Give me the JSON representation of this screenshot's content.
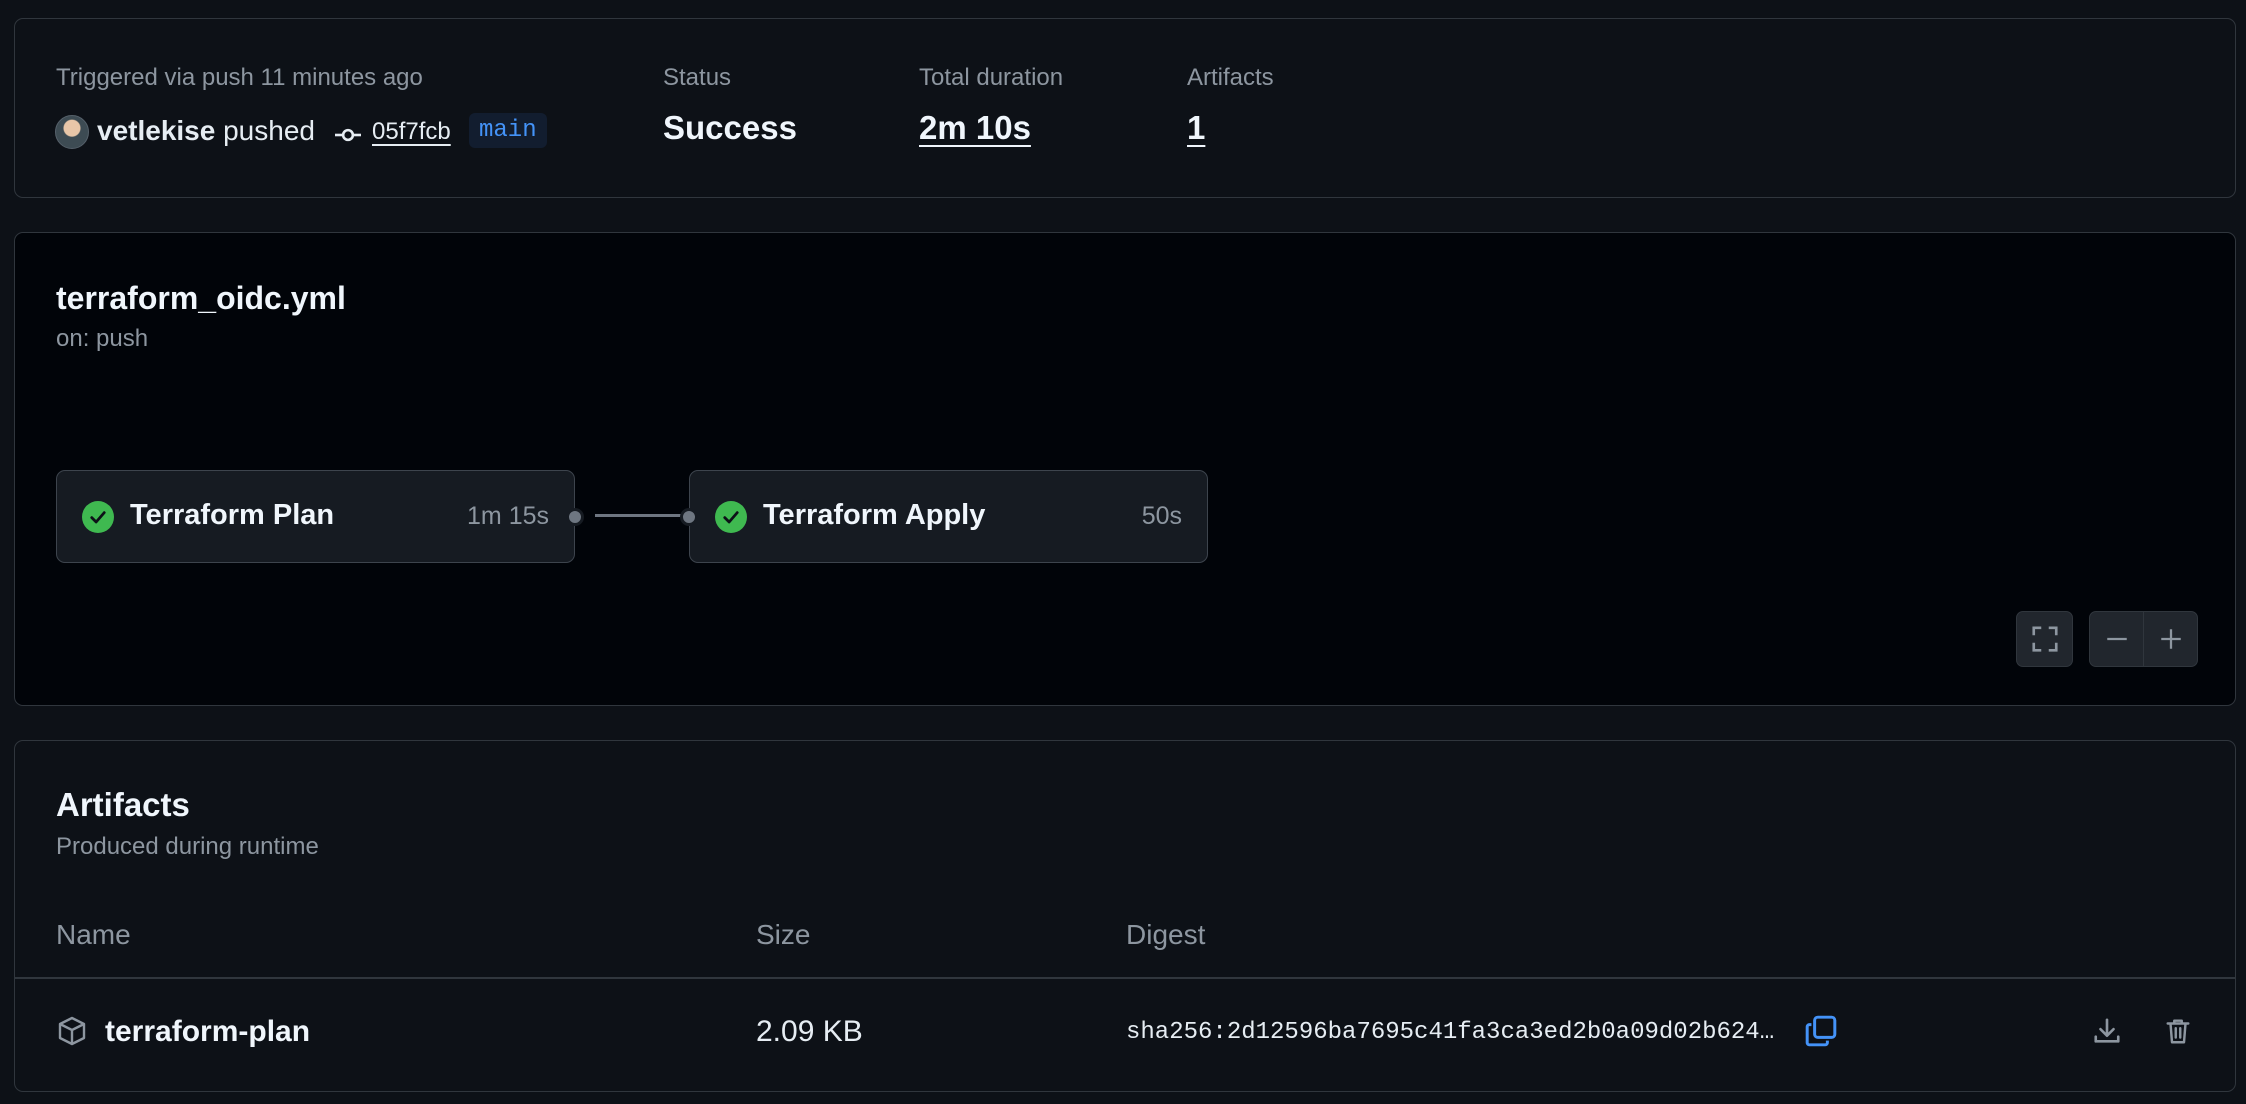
{
  "summary": {
    "trigger_text": "Triggered via push 11 minutes ago",
    "actor": "vetlekise",
    "action": "pushed",
    "commit_sha": "05f7fcb",
    "branch": "main",
    "status_label": "Status",
    "status_value": "Success",
    "duration_label": "Total duration",
    "duration_value": "2m 10s",
    "artifacts_label": "Artifacts",
    "artifacts_value": "1"
  },
  "workflow": {
    "filename": "terraform_oidc.yml",
    "event": "on: push",
    "jobs": [
      {
        "name": "Terraform Plan",
        "duration": "1m 15s",
        "status": "success"
      },
      {
        "name": "Terraform Apply",
        "duration": "50s",
        "status": "success"
      }
    ],
    "controls": [
      "fullscreen-icon",
      "zoom-out-icon",
      "zoom-in-icon"
    ]
  },
  "artifacts": {
    "title": "Artifacts",
    "subtitle": "Produced during runtime",
    "columns": [
      "Name",
      "Size",
      "Digest"
    ],
    "rows": [
      {
        "name": "terraform-plan",
        "size": "2.09 KB",
        "digest": "sha256:2d12596ba7695c41fa3ca3ed2b0a09d02b624…"
      }
    ]
  },
  "colors": {
    "background": "#0d1117",
    "graph_background": "#010409",
    "border": "#30363d",
    "success": "#3fb950",
    "accent": "#4493f8",
    "muted_text": "#8d96a0"
  }
}
